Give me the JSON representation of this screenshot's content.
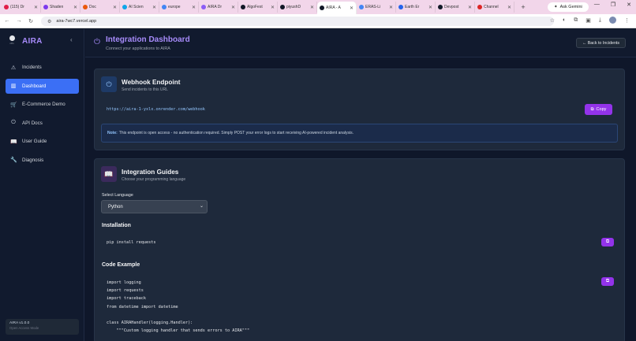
{
  "browser": {
    "tabs": [
      {
        "label": "(115) Dr",
        "color": "#e11d48"
      },
      {
        "label": "Shaden",
        "color": "#7c3aed"
      },
      {
        "label": "Doc",
        "color": "#ea580c"
      },
      {
        "label": "AI Scien",
        "color": "#0ea5e9"
      },
      {
        "label": "europe",
        "color": "#4285f4"
      },
      {
        "label": "AIRA Dr",
        "color": "#8b5cf6"
      },
      {
        "label": "AlgoFest",
        "color": "#111827"
      },
      {
        "label": "piyushD",
        "color": "#111827"
      },
      {
        "label": "AIRA - A",
        "color": "#111827"
      },
      {
        "label": "ERAS-Li",
        "color": "#4285f4"
      },
      {
        "label": "Earth Er",
        "color": "#2563eb"
      },
      {
        "label": "Devpost",
        "color": "#111827"
      },
      {
        "label": "Channel",
        "color": "#dc2626"
      }
    ],
    "active_tab_index": 8,
    "gemini_label": "Ask Gemini",
    "url": "aira-7wc7.vercel.app"
  },
  "sidebar": {
    "brand": "AIRA",
    "logo_sub": "n8n",
    "items": [
      {
        "label": "Incidents",
        "icon": "warning-icon",
        "glyph": "⚠"
      },
      {
        "label": "Dashboard",
        "icon": "chart-icon",
        "glyph": "▥"
      },
      {
        "label": "E-Commerce Demo",
        "icon": "cart-icon",
        "glyph": "🛒"
      },
      {
        "label": "API Docs",
        "icon": "plug-icon",
        "glyph": "⏻"
      },
      {
        "label": "User Guide",
        "icon": "book-icon",
        "glyph": "📖"
      },
      {
        "label": "Diagnosis",
        "icon": "wrench-icon",
        "glyph": "🔧"
      }
    ],
    "active_index": 1,
    "version": "AIRA v1.0.0",
    "mode": "Open Access Mode"
  },
  "header": {
    "title": "Integration Dashboard",
    "subtitle": "Connect your applications to AIRA",
    "back_label": "← Back to Incidents"
  },
  "webhook": {
    "title": "Webhook Endpoint",
    "subtitle": "Send incidents to this URL",
    "url": "https://aira-1-yxlx.onrender.com/webhook",
    "copy_label": "Copy",
    "note_label": "Note:",
    "note_text": "This endpoint is open access - no authentication required. Simply POST your error logs to start receiving AI-powered incident analysis."
  },
  "guides": {
    "title": "Integration Guides",
    "subtitle": "Choose your programming language",
    "select_label": "Select Language",
    "selected_language": "Python",
    "installation_title": "Installation",
    "install_cmd": "pip install requests",
    "code_title": "Code Example",
    "code": "import logging\nimport requests\nimport traceback\nfrom datetime import datetime\n\nclass AIRAHandler(logging.Handler):\n    \"\"\"Custom logging handler that sends errors to AIRA\"\"\""
  }
}
